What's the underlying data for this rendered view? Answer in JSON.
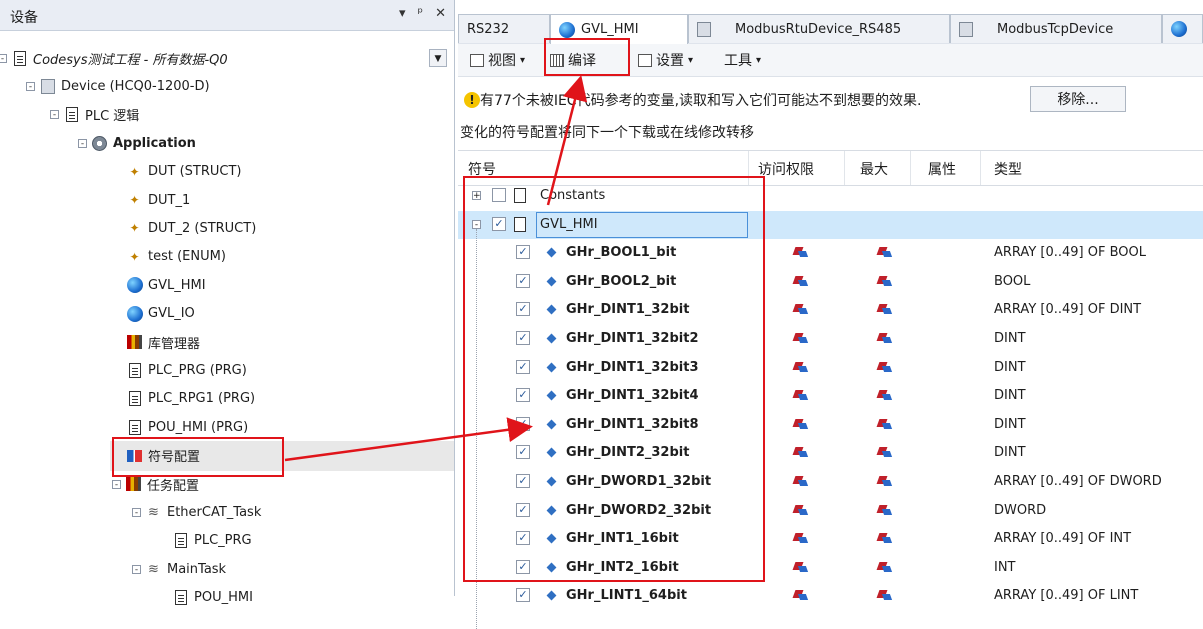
{
  "left_panel": {
    "title": "设备",
    "controls": [
      "▾",
      "ᵖ",
      "✕"
    ],
    "tree": [
      {
        "label": "Codesys测试工程 - 所有数据-Q0",
        "icon": "project-icon",
        "italic": true
      },
      {
        "label": "Device (HCQ0-1200-D)",
        "icon": "device-icon"
      },
      {
        "label": "PLC 逻辑",
        "icon": "plc-logic-icon"
      },
      {
        "label": "Application",
        "icon": "application-gear-icon",
        "bold": true
      },
      {
        "label": "DUT (STRUCT)",
        "icon": "dut-icon"
      },
      {
        "label": "DUT_1",
        "icon": "dut-icon"
      },
      {
        "label": "DUT_2 (STRUCT)",
        "icon": "dut-icon"
      },
      {
        "label": "test (ENUM)",
        "icon": "dut-icon"
      },
      {
        "label": "GVL_HMI",
        "icon": "globe-icon"
      },
      {
        "label": "GVL_IO",
        "icon": "globe-icon"
      },
      {
        "label": "库管理器",
        "icon": "library-icon"
      },
      {
        "label": "PLC_PRG (PRG)",
        "icon": "document-icon"
      },
      {
        "label": "PLC_RPG1 (PRG)",
        "icon": "document-icon"
      },
      {
        "label": "POU_HMI (PRG)",
        "icon": "document-icon"
      },
      {
        "label": "符号配置",
        "icon": "symbol-config-icon"
      },
      {
        "label": "任务配置",
        "icon": "task-config-icon"
      },
      {
        "label": "EtherCAT_Task",
        "icon": "task-icon"
      },
      {
        "label": "PLC_PRG",
        "icon": "program-call-icon"
      },
      {
        "label": "MainTask",
        "icon": "task-icon"
      },
      {
        "label": "POU_HMI",
        "icon": "program-call-icon"
      }
    ]
  },
  "tabs": [
    {
      "label": "RS232",
      "icon": ""
    },
    {
      "label": "GVL_HMI",
      "icon": "globe-icon"
    },
    {
      "label": "ModbusRtuDevice_RS485",
      "icon": "device-icon"
    },
    {
      "label": "ModbusTcpDevice",
      "icon": "device-icon"
    },
    {
      "label": "",
      "icon": "globe-icon"
    }
  ],
  "toolbar": {
    "view": "视图",
    "compile": "编译",
    "settings": "设置",
    "tools": "工具"
  },
  "warning": {
    "text": "有77个未被IEC代码参考的变量,读取和写入它们可能达不到想要的效果.",
    "remove_button": "移除...",
    "info": "变化的符号配置将同下一个下载或在线修改转移"
  },
  "grid": {
    "columns": [
      "符号",
      "访问权限",
      "最大",
      "属性",
      "类型"
    ],
    "groups": [
      {
        "label": "Constants",
        "checked": false,
        "expanded": false
      },
      {
        "label": "GVL_HMI",
        "checked": true,
        "expanded": true
      }
    ],
    "rows": [
      {
        "name": "GHr_BOOL1_bit",
        "type": "ARRAY [0..49] OF BOOL"
      },
      {
        "name": "GHr_BOOL2_bit",
        "type": "BOOL"
      },
      {
        "name": "GHr_DINT1_32bit",
        "type": "ARRAY [0..49] OF DINT"
      },
      {
        "name": "GHr_DINT1_32bit2",
        "type": "DINT"
      },
      {
        "name": "GHr_DINT1_32bit3",
        "type": "DINT"
      },
      {
        "name": "GHr_DINT1_32bit4",
        "type": "DINT"
      },
      {
        "name": "GHr_DINT1_32bit8",
        "type": "DINT"
      },
      {
        "name": "GHr_DINT2_32bit",
        "type": "DINT"
      },
      {
        "name": "GHr_DWORD1_32bit",
        "type": "ARRAY [0..49] OF DWORD"
      },
      {
        "name": "GHr_DWORD2_32bit",
        "type": "DWORD"
      },
      {
        "name": "GHr_INT1_16bit",
        "type": "ARRAY [0..49] OF INT"
      },
      {
        "name": "GHr_INT2_16bit",
        "type": "INT"
      },
      {
        "name": "GHr_LINT1_64bit",
        "type": "ARRAY [0..49] OF LINT"
      }
    ]
  },
  "colors": {
    "highlight": "#e0141a",
    "selection": "#cfe8fb",
    "accent": "#2f6fc2"
  }
}
